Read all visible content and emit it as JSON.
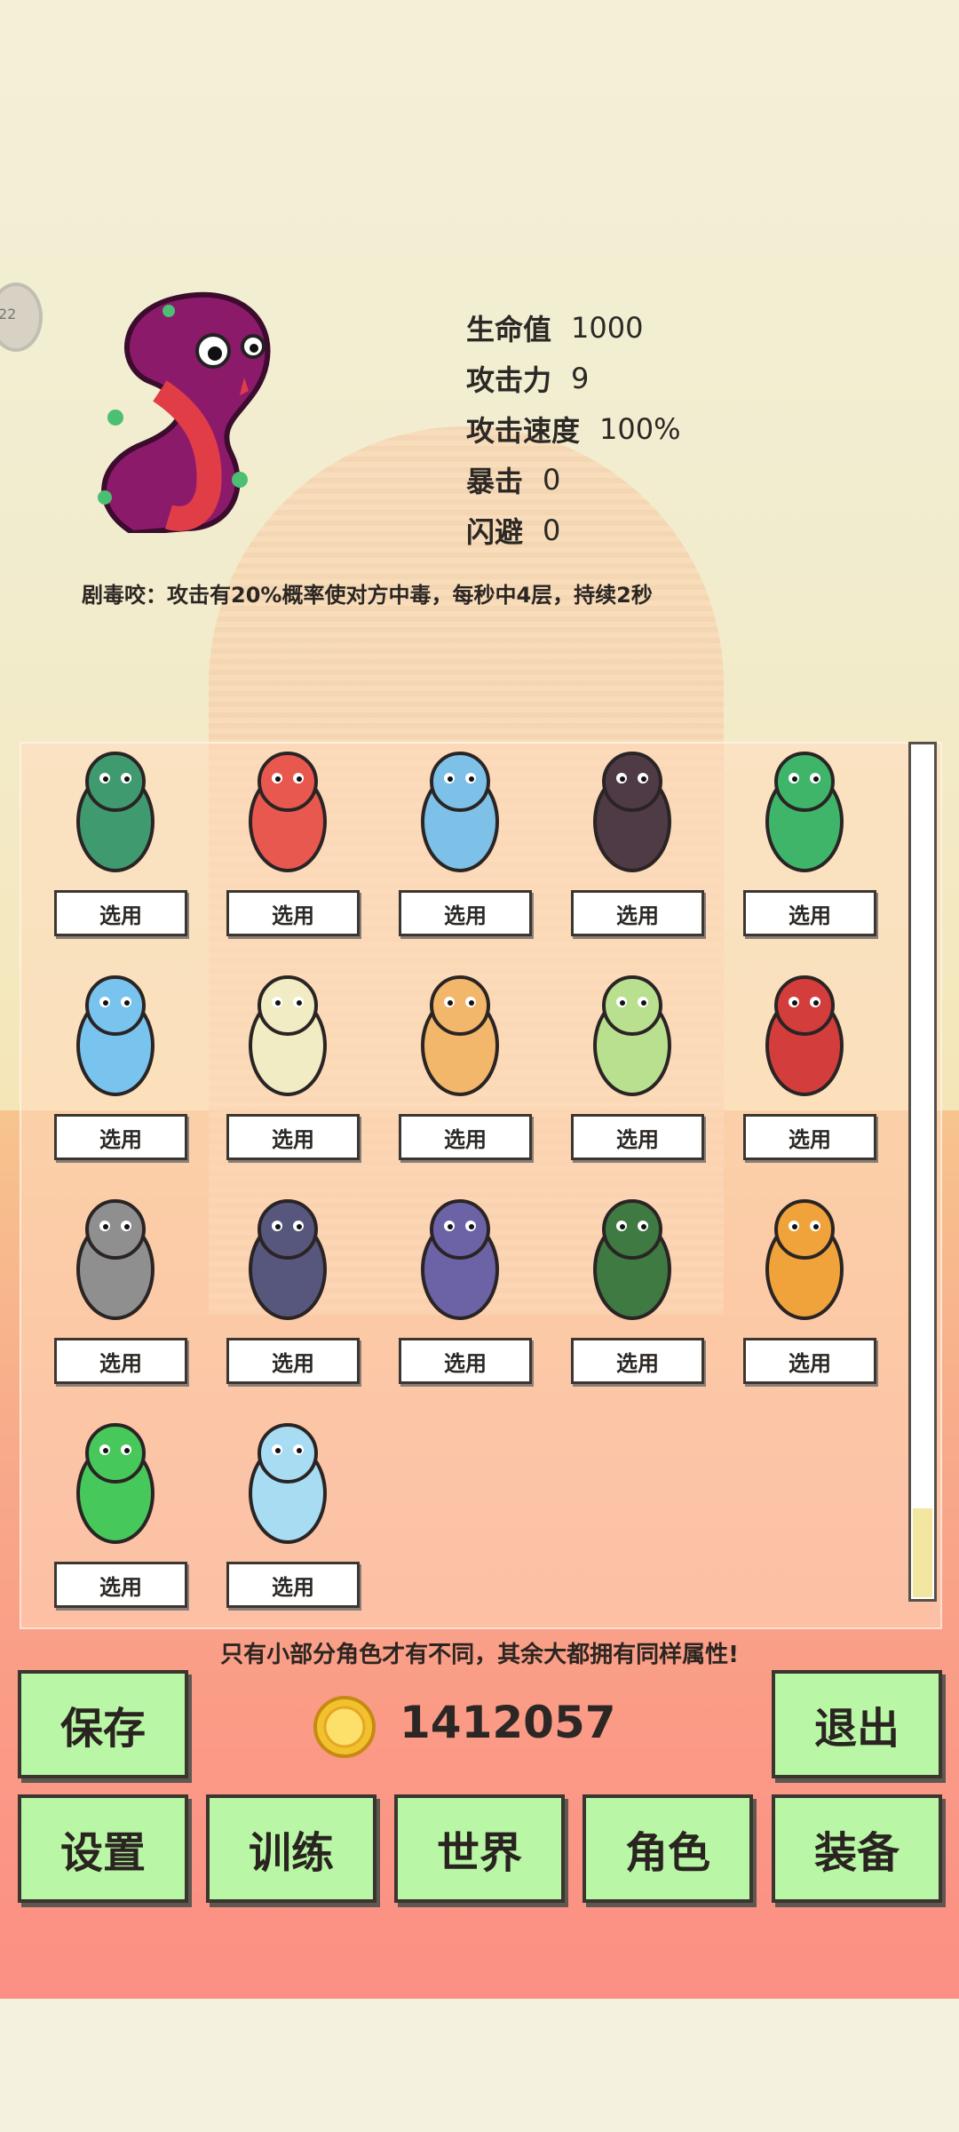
{
  "hero": {
    "name_icon": "cobra-sprite",
    "stats": [
      {
        "label": "生命值",
        "value": "1000"
      },
      {
        "label": "攻击力",
        "value": "9"
      },
      {
        "label": "攻击速度",
        "value": "100%"
      },
      {
        "label": "暴击",
        "value": "0"
      },
      {
        "label": "闪避",
        "value": "0"
      }
    ],
    "skill": "剧毒咬：攻击有20%概率使对方中毒，每秒中4层，持续2秒"
  },
  "side_bubble": "22",
  "roster": {
    "select_label": "选用",
    "characters": [
      {
        "icon": "green-toad-warrior",
        "color": "#3f9a6f"
      },
      {
        "icon": "red-fox-with-pig",
        "color": "#e8584f"
      },
      {
        "icon": "blue-shark-spearman",
        "color": "#7ec1e8"
      },
      {
        "icon": "dark-rock-golem",
        "color": "#4e3b45"
      },
      {
        "icon": "blonde-mermaid",
        "color": "#3fb56a"
      },
      {
        "icon": "blue-furry-beast",
        "color": "#79c3ef"
      },
      {
        "icon": "white-duck-warrior",
        "color": "#f1ecc4"
      },
      {
        "icon": "striped-worm-monster",
        "color": "#f2b76a"
      },
      {
        "icon": "green-dragon",
        "color": "#b9e08f"
      },
      {
        "icon": "red-horned-demon",
        "color": "#d33d3b"
      },
      {
        "icon": "gray-blob-ghost",
        "color": "#8f8f8f"
      },
      {
        "icon": "three-headed-wolf",
        "color": "#57577e"
      },
      {
        "icon": "blue-bat",
        "color": "#6c63a6"
      },
      {
        "icon": "leafy-toad",
        "color": "#3e7a41"
      },
      {
        "icon": "fire-spirit",
        "color": "#f0a33a"
      },
      {
        "icon": "green-spring-spirit",
        "color": "#46c85a"
      },
      {
        "icon": "blue-water-spirit",
        "color": "#a7dcf3"
      }
    ]
  },
  "note": "只有小部分角色才有不同，其余大都拥有同样属性!",
  "coins": "1412057",
  "buttons": {
    "save": "保存",
    "exit": "退出",
    "settings": "设置",
    "train": "训练",
    "world": "世界",
    "character": "角色",
    "equipment": "装备"
  }
}
